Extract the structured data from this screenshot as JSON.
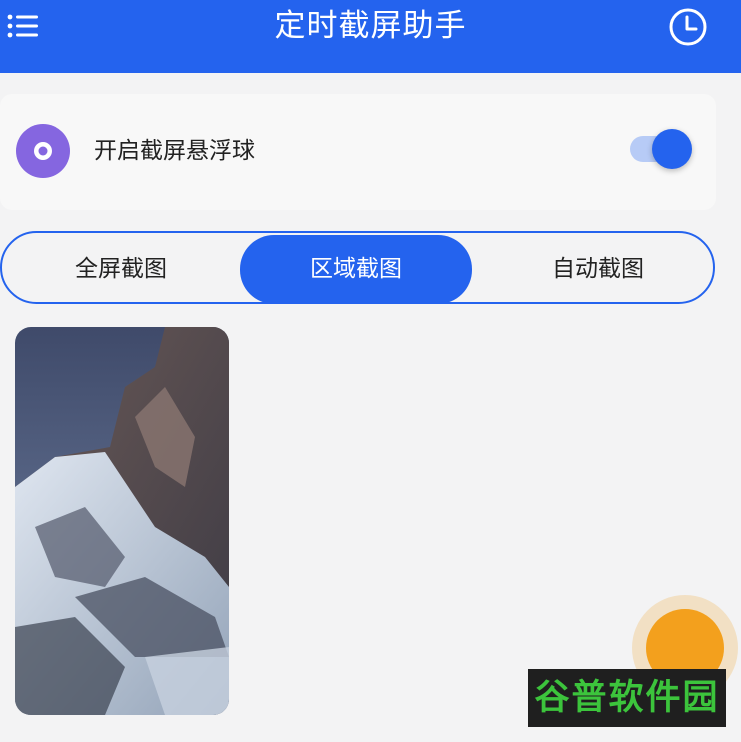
{
  "header": {
    "title": "定时截屏助手",
    "menu_icon": "menu-icon",
    "history_icon": "clock-icon"
  },
  "float_ball": {
    "label": "开启截屏悬浮球",
    "icon": "float-ball-icon",
    "enabled": true
  },
  "tabs": [
    {
      "label": "全屏截图",
      "active": false
    },
    {
      "label": "区域截图",
      "active": true
    },
    {
      "label": "自动截图",
      "active": false
    }
  ],
  "screenshots": [
    {
      "kind": "mountain-snow-photo"
    }
  ],
  "watermark": {
    "text": "谷普软件园"
  },
  "colors": {
    "primary": "#2463ee",
    "float_ball_accent": "#8566e0",
    "fab": "#f3a01d",
    "watermark_text": "#3cc43c"
  }
}
